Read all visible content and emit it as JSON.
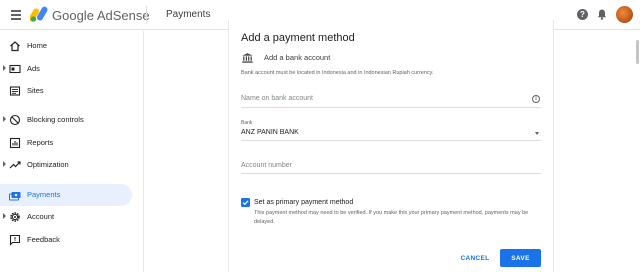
{
  "header": {
    "brand": "Google AdSense",
    "page_title": "Payments",
    "help_glyph": "?",
    "icons": [
      "menu-icon",
      "adsense-logo",
      "help-icon",
      "bell-icon",
      "avatar"
    ]
  },
  "sidebar": {
    "items": [
      {
        "label": "Home",
        "icon": "home-icon",
        "expandable": false,
        "active": false
      },
      {
        "label": "Ads",
        "icon": "ads-icon",
        "expandable": true,
        "active": false
      },
      {
        "label": "Sites",
        "icon": "sites-icon",
        "expandable": false,
        "active": false
      },
      {
        "label": "Blocking controls",
        "icon": "block-icon",
        "expandable": true,
        "active": false
      },
      {
        "label": "Reports",
        "icon": "reports-icon",
        "expandable": false,
        "active": false
      },
      {
        "label": "Optimization",
        "icon": "trending-icon",
        "expandable": true,
        "active": false
      },
      {
        "label": "Payments",
        "icon": "payments-icon",
        "expandable": false,
        "active": true
      },
      {
        "label": "Account",
        "icon": "gear-icon",
        "expandable": true,
        "active": false
      },
      {
        "label": "Feedback",
        "icon": "feedback-icon",
        "expandable": false,
        "active": false
      }
    ]
  },
  "form": {
    "title": "Add a payment method",
    "option_label": "Add a bank account",
    "note": "Bank account must be located in Indonesia and in Indonesian Rupiah currency.",
    "name_placeholder": "Name on bank account",
    "info_glyph": "i",
    "bank_label": "Bank",
    "bank_value": "ANZ PANIN BANK",
    "account_placeholder": "Account number",
    "primary_checked": true,
    "primary_label": "Set as primary payment method",
    "primary_help": "This payment method may need to be verified. If you make this your primary payment method, payments may be delayed.",
    "cancel_label": "CANCEL",
    "save_label": "SAVE"
  },
  "colors": {
    "accent": "#1a73e8",
    "active_nav_bg": "#e8f0fe",
    "text": "#202124",
    "muted": "#5f6368"
  }
}
